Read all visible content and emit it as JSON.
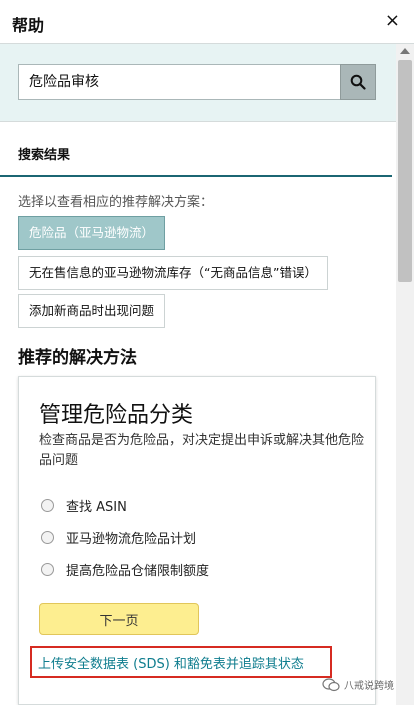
{
  "header": {
    "title": "帮助",
    "close": "×"
  },
  "search": {
    "value": "危险品审核"
  },
  "results": {
    "heading": "搜索结果",
    "prompt": "选择以查看相应的推荐解决方案：",
    "chips": [
      "危险品（亚马逊物流）",
      "无在售信息的亚马逊物流库存（“无商品信息”错误）",
      "添加新商品时出现问题"
    ]
  },
  "solutions": {
    "heading": "推荐的解决方法",
    "card": {
      "title": "管理危险品分类",
      "description": "检查商品是否为危险品，对决定提出申诉或解决其他危险品问题",
      "options": [
        "查找 ASIN",
        "亚马逊物流危险品计划",
        "提高危险品仓储限制额度"
      ],
      "next_label": "下一页"
    },
    "link": "上传安全数据表 (SDS) 和豁免表并追踪其状态"
  },
  "watermark": "八戒说跨境",
  "colors": {
    "accent": "#1b6673",
    "chip_active": "#9fc7c9",
    "next_button": "#fdee90",
    "highlight_box": "#d62b21",
    "link": "#0f7d8e"
  }
}
